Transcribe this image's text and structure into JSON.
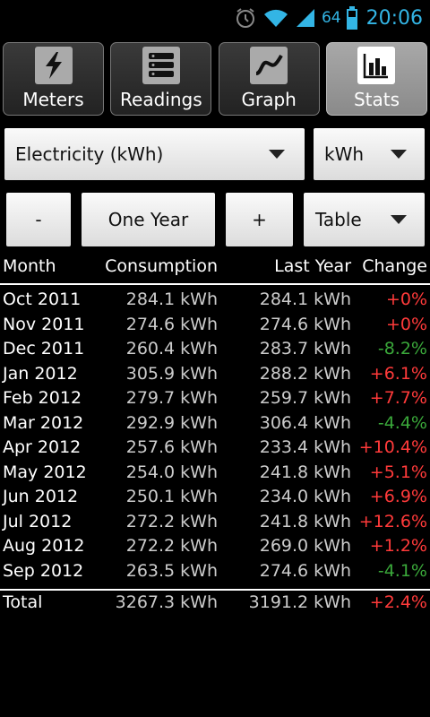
{
  "status": {
    "battery": "64",
    "time": "20:06"
  },
  "tabs": [
    {
      "label": "Meters",
      "icon": "lightning-icon"
    },
    {
      "label": "Readings",
      "icon": "list-icon"
    },
    {
      "label": "Graph",
      "icon": "graph-icon"
    },
    {
      "label": "Stats",
      "icon": "bar-chart-icon",
      "active": true
    }
  ],
  "controls": {
    "meter_select": "Electricity (kWh)",
    "unit_select": "kWh",
    "prev_button": "-",
    "period_button": "One Year",
    "next_button": "+",
    "view_select": "Table"
  },
  "table": {
    "headers": {
      "month": "Month",
      "consumption": "Consumption",
      "last_year": "Last Year",
      "change": "Change"
    },
    "rows": [
      {
        "month": "Oct 2011",
        "consumption": "284.1 kWh",
        "last_year": "284.1 kWh",
        "change": "+0%"
      },
      {
        "month": "Nov 2011",
        "consumption": "274.6 kWh",
        "last_year": "274.6 kWh",
        "change": "+0%"
      },
      {
        "month": "Dec 2011",
        "consumption": "260.4 kWh",
        "last_year": "283.7 kWh",
        "change": "-8.2%"
      },
      {
        "month": "Jan 2012",
        "consumption": "305.9 kWh",
        "last_year": "288.2 kWh",
        "change": "+6.1%"
      },
      {
        "month": "Feb 2012",
        "consumption": "279.7 kWh",
        "last_year": "259.7 kWh",
        "change": "+7.7%"
      },
      {
        "month": "Mar 2012",
        "consumption": "292.9 kWh",
        "last_year": "306.4 kWh",
        "change": "-4.4%"
      },
      {
        "month": "Apr 2012",
        "consumption": "257.6 kWh",
        "last_year": "233.4 kWh",
        "change": "+10.4%"
      },
      {
        "month": "May 2012",
        "consumption": "254.0 kWh",
        "last_year": "241.8 kWh",
        "change": "+5.1%"
      },
      {
        "month": "Jun 2012",
        "consumption": "250.1 kWh",
        "last_year": "234.0 kWh",
        "change": "+6.9%"
      },
      {
        "month": "Jul 2012",
        "consumption": "272.2 kWh",
        "last_year": "241.8 kWh",
        "change": "+12.6%"
      },
      {
        "month": "Aug 2012",
        "consumption": "272.2 kWh",
        "last_year": "269.0 kWh",
        "change": "+1.2%"
      },
      {
        "month": "Sep 2012",
        "consumption": "263.5 kWh",
        "last_year": "274.6 kWh",
        "change": "-4.1%"
      }
    ],
    "total": {
      "month": "Total",
      "consumption": "3267.3 kWh",
      "last_year": "3191.2 kWh",
      "change": "+2.4%"
    }
  },
  "colors": {
    "increase": "#ff3a3a",
    "decrease": "#3aa83a",
    "status_blue": "#33b5e5"
  }
}
